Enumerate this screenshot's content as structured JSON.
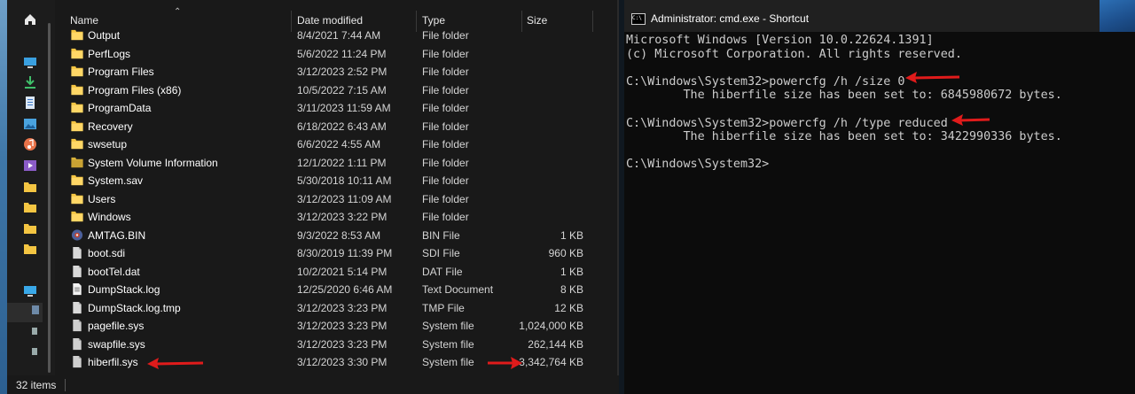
{
  "explorer": {
    "columns": {
      "name": "Name",
      "date": "Date modified",
      "type": "Type",
      "size": "Size"
    },
    "rows": [
      {
        "name": "Output",
        "date": "8/4/2021 7:44 AM",
        "type": "File folder",
        "size": "",
        "icon": "folder-icon"
      },
      {
        "name": "PerfLogs",
        "date": "5/6/2022 11:24 PM",
        "type": "File folder",
        "size": "",
        "icon": "folder-icon"
      },
      {
        "name": "Program Files",
        "date": "3/12/2023 2:52 PM",
        "type": "File folder",
        "size": "",
        "icon": "folder-icon"
      },
      {
        "name": "Program Files (x86)",
        "date": "10/5/2022 7:15 AM",
        "type": "File folder",
        "size": "",
        "icon": "folder-icon"
      },
      {
        "name": "ProgramData",
        "date": "3/11/2023 11:59 AM",
        "type": "File folder",
        "size": "",
        "icon": "folder-icon"
      },
      {
        "name": "Recovery",
        "date": "6/18/2022 6:43 AM",
        "type": "File folder",
        "size": "",
        "icon": "folder-icon"
      },
      {
        "name": "swsetup",
        "date": "6/6/2022 4:55 AM",
        "type": "File folder",
        "size": "",
        "icon": "folder-icon"
      },
      {
        "name": "System Volume Information",
        "date": "12/1/2022 1:11 PM",
        "type": "File folder",
        "size": "",
        "icon": "folder-locked-icon"
      },
      {
        "name": "System.sav",
        "date": "5/30/2018 10:11 AM",
        "type": "File folder",
        "size": "",
        "icon": "folder-icon"
      },
      {
        "name": "Users",
        "date": "3/12/2023 11:09 AM",
        "type": "File folder",
        "size": "",
        "icon": "folder-icon"
      },
      {
        "name": "Windows",
        "date": "3/12/2023 3:22 PM",
        "type": "File folder",
        "size": "",
        "icon": "folder-icon"
      },
      {
        "name": "AMTAG.BIN",
        "date": "9/3/2022 8:53 AM",
        "type": "BIN File",
        "size": "1 KB",
        "icon": "bin-file-icon"
      },
      {
        "name": "boot.sdi",
        "date": "8/30/2019 11:39 PM",
        "type": "SDI File",
        "size": "960 KB",
        "icon": "file-icon"
      },
      {
        "name": "bootTel.dat",
        "date": "10/2/2021 5:14 PM",
        "type": "DAT File",
        "size": "1 KB",
        "icon": "file-icon"
      },
      {
        "name": "DumpStack.log",
        "date": "12/25/2020 6:46 AM",
        "type": "Text Document",
        "size": "8 KB",
        "icon": "text-file-icon"
      },
      {
        "name": "DumpStack.log.tmp",
        "date": "3/12/2023 3:23 PM",
        "type": "TMP File",
        "size": "12 KB",
        "icon": "file-icon"
      },
      {
        "name": "pagefile.sys",
        "date": "3/12/2023 3:23 PM",
        "type": "System file",
        "size": "1,024,000 KB",
        "icon": "system-file-icon"
      },
      {
        "name": "swapfile.sys",
        "date": "3/12/2023 3:23 PM",
        "type": "System file",
        "size": "262,144 KB",
        "icon": "system-file-icon"
      },
      {
        "name": "hiberfil.sys",
        "date": "3/12/2023 3:30 PM",
        "type": "System file",
        "size": "3,342,764 KB",
        "icon": "system-file-icon"
      }
    ],
    "status": {
      "item_count": "32 items"
    },
    "nav_icons": [
      "home-icon",
      "desktop-icon",
      "downloads-icon",
      "documents-icon",
      "pictures-icon",
      "music-icon",
      "videos-icon",
      "folder-icon",
      "folder-icon",
      "folder-icon",
      "folder-icon",
      "this-pc-icon"
    ]
  },
  "cmd": {
    "title": "Administrator: cmd.exe - Shortcut",
    "lines": [
      "Microsoft Windows [Version 10.0.22624.1391]",
      "(c) Microsoft Corporation. All rights reserved.",
      "",
      "C:\\Windows\\System32>powercfg /h /size 0",
      "        The hiberfile size has been set to: 6845980672 bytes.",
      "",
      "C:\\Windows\\System32>powercfg /h /type reduced",
      "        The hiberfile size has been set to: 3422990336 bytes.",
      "",
      "C:\\Windows\\System32>"
    ]
  },
  "colors": {
    "folder": "#f4c542",
    "annotation_arrow": "#e01b1b",
    "console_text": "#cccccc",
    "explorer_bg": "#191919"
  }
}
